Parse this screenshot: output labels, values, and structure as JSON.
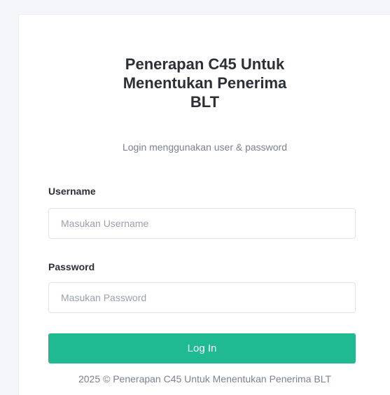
{
  "login": {
    "title_line1": "Penerapan C45 Untuk",
    "title_line2": "Menentukan Penerima",
    "title_line3": "BLT",
    "subtitle": "Login menggunakan user & password",
    "username_label": "Username",
    "username_placeholder": "Masukan Username",
    "username_value": "",
    "password_label": "Password",
    "password_placeholder": "Masukan Password",
    "password_value": "",
    "login_button": "Log In",
    "footer": "2025 © Penerapan C45 Untuk Menentukan Penerima BLT"
  },
  "colors": {
    "accent": "#1fba91",
    "page_background": "#f4f5f8",
    "card_background": "#ffffff"
  }
}
